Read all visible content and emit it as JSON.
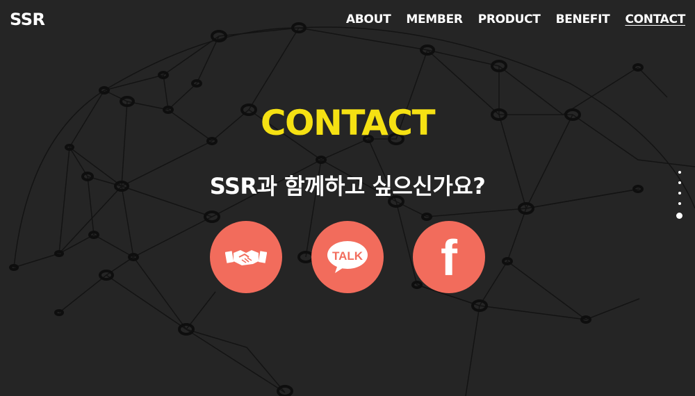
{
  "header": {
    "logo": "SSR",
    "nav": [
      {
        "label": "ABOUT"
      },
      {
        "label": "MEMBER"
      },
      {
        "label": "PRODUCT"
      },
      {
        "label": "BENEFIT"
      },
      {
        "label": "CONTACT",
        "active": true
      }
    ]
  },
  "main": {
    "title": "CONTACT",
    "subtitle": "SSR과 함께하고 싶으신가요?",
    "contact_buttons": [
      {
        "icon": "handshake-icon"
      },
      {
        "icon": "kakaotalk-icon",
        "label": "TALK"
      },
      {
        "icon": "facebook-icon",
        "label": "f"
      }
    ]
  },
  "section_dots": {
    "count": 5,
    "active_index": 4
  },
  "colors": {
    "background": "#252525",
    "title_accent": "#f5e113",
    "button": "#f26c5c",
    "text": "#ffffff"
  }
}
